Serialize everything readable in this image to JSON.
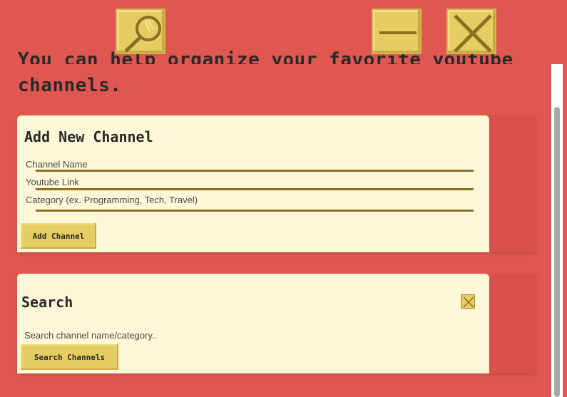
{
  "toolbar": {
    "search_icon": "magnifier-icon",
    "minimize_icon": "minimize-icon",
    "close_icon": "close-icon"
  },
  "intro": {
    "line1": "You can help organize your favorite youtube",
    "line2": "channels."
  },
  "add_channel": {
    "title": "Add New Channel",
    "fields": [
      {
        "placeholder": "Channel Name"
      },
      {
        "placeholder": "Youtube Link"
      },
      {
        "placeholder": "Category (ex. Programming, Tech, Travel)"
      }
    ],
    "button_label": "Add Channel"
  },
  "search": {
    "title": "Search",
    "placeholder": "Search channel name/category..",
    "button_label": "Search Channels"
  },
  "colors": {
    "background": "#e05752",
    "card": "#fef8d8",
    "button": "#e6cd63",
    "line": "#8a7022"
  }
}
